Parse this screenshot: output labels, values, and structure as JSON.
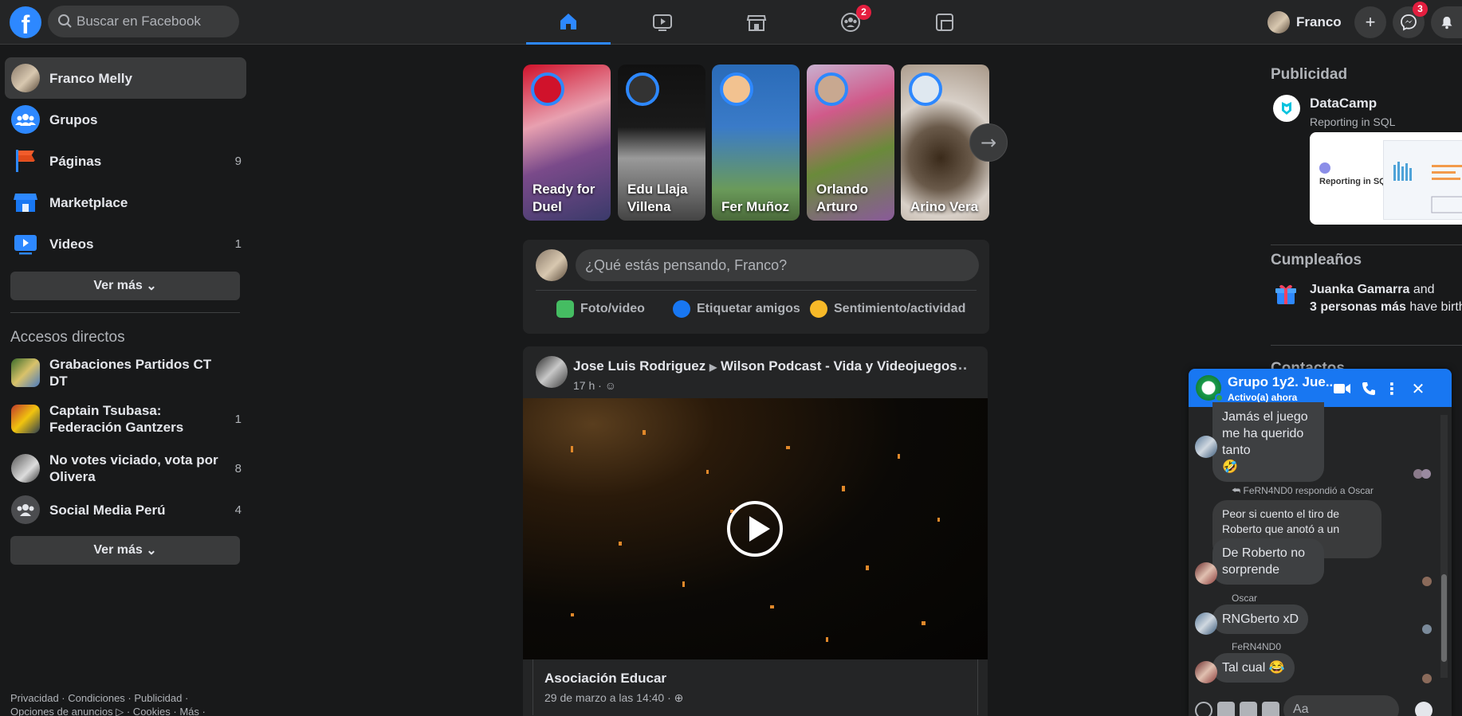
{
  "topbar": {
    "logo": "f",
    "search_placeholder": "Buscar en Facebook",
    "groups_badge": "2",
    "user_name": "Franco",
    "messenger_badge": "3",
    "plus": "+"
  },
  "left": {
    "items": [
      {
        "label": "Franco Melly",
        "count": ""
      },
      {
        "label": "Grupos",
        "count": ""
      },
      {
        "label": "Páginas",
        "count": "9"
      },
      {
        "label": "Marketplace",
        "count": ""
      },
      {
        "label": "Videos",
        "count": "1"
      }
    ],
    "ver_mas": "Ver más",
    "shortcuts_heading": "Accesos directos",
    "shortcuts": [
      {
        "label": "Grabaciones Partidos CT DT",
        "count": ""
      },
      {
        "label": "Captain Tsubasa: Federación Gantzers",
        "count": "1"
      },
      {
        "label": "No votes viciado, vota por Olivera",
        "count": "8"
      },
      {
        "label": "Social Media Perú",
        "count": "4"
      }
    ],
    "ver_mas_2": "Ver más",
    "footer_line1": "Privacidad · Condiciones · Publicidad ·",
    "footer_line2": "Opciones de anuncios ▷ · Cookies · Más ·"
  },
  "stories": [
    {
      "name": "Ready for Duel"
    },
    {
      "name": "Edu Llaja Villena"
    },
    {
      "name": "Fer Muñoz"
    },
    {
      "name": "Orlando Arturo"
    },
    {
      "name": "Arino Vera"
    }
  ],
  "composer": {
    "placeholder": "¿Qué estás pensando, Franco?",
    "actions": [
      "Foto/video",
      "Etiquetar amigos",
      "Sentimiento/actividad"
    ]
  },
  "post": {
    "author": "Jose Luis Rodriguez",
    "target": "Wilson Podcast - Vida y Videojuegos",
    "time": "17 h ·",
    "more": "···",
    "shared_title": "Asociación Educar",
    "shared_date": "29 de marzo a las 14:40 ·"
  },
  "right": {
    "ads_heading": "Publicidad",
    "ad_name": "DataCamp",
    "ad_sub": "Reporting in SQL",
    "ad_image_text": "Reporting in SQL",
    "bday_heading": "Cumpleaños",
    "bday_bold": "Juanka Gamarra",
    "bday_and": " and ",
    "bday_bold2": "3 personas más",
    "bday_rest": " have birthdays today",
    "contacts_heading": "Contactos"
  },
  "chat": {
    "title": "Grupo 1y2. Jue...",
    "status": "Activo(a) ahora",
    "messages": [
      {
        "text": "Jamás el juego me ha querido tanto",
        "emoji": "🤣"
      },
      {
        "reply_note": "FeRN4ND0 respondió a Oscar"
      },
      {
        "text": "Peor si cuento el tiro de Roberto que anotó a un Genzo Fest."
      },
      {
        "text": "De Roberto no sorprende"
      },
      {
        "sender": "Oscar",
        "text": "RNGberto xD"
      },
      {
        "sender": "FeRN4ND0",
        "text": "Tal cual",
        "emoji": "😂"
      }
    ],
    "input_placeholder": "Aa"
  },
  "colors": {
    "accent": "#2d88ff",
    "badge": "#e41e3f",
    "chat_header": "#1877f2"
  }
}
